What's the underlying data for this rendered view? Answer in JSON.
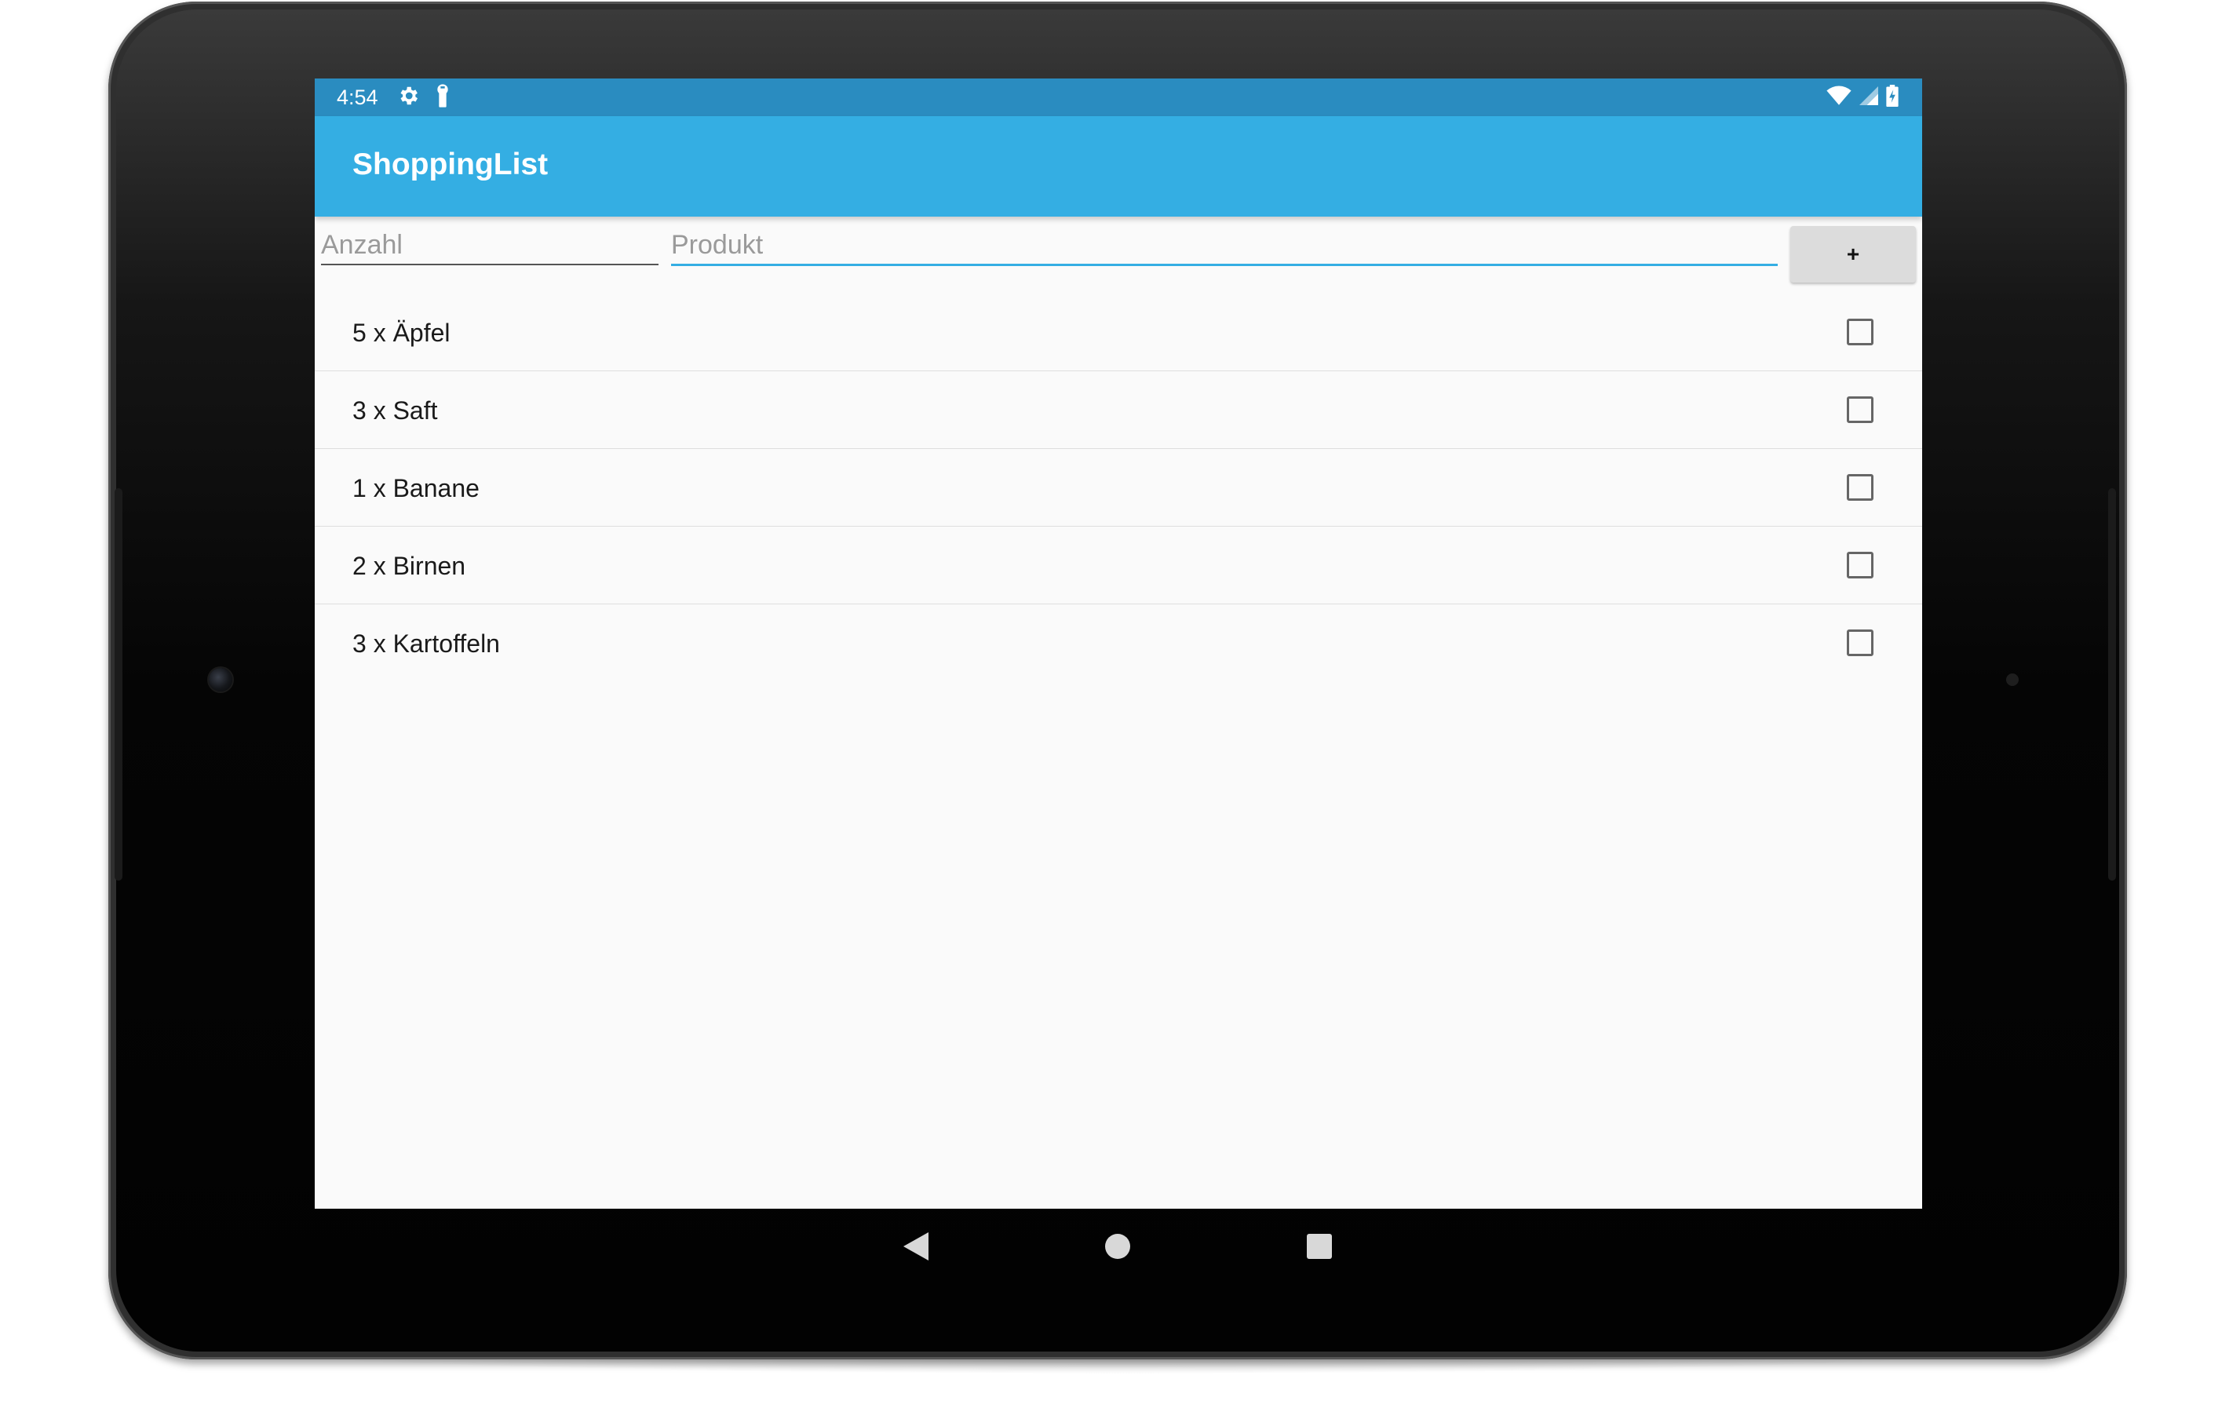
{
  "status_bar": {
    "time": "4:54",
    "left_icons": [
      "gear-icon",
      "key-icon"
    ],
    "right_icons": [
      "wifi-icon",
      "signal-icon",
      "battery-icon"
    ]
  },
  "app_bar": {
    "title": "ShoppingList"
  },
  "input_row": {
    "quantity_placeholder": "Anzahl",
    "quantity_value": "",
    "product_placeholder": "Produkt",
    "product_value": "",
    "add_button_label": "+"
  },
  "items": [
    {
      "label": "5 x Äpfel",
      "checked": false
    },
    {
      "label": "3 x Saft",
      "checked": false
    },
    {
      "label": "1 x Banane",
      "checked": false
    },
    {
      "label": "2 x Birnen",
      "checked": false
    },
    {
      "label": "3 x Kartoffeln",
      "checked": false
    }
  ],
  "nav_bar": {
    "icons": [
      "back-icon",
      "home-icon",
      "recents-icon"
    ]
  },
  "colors": {
    "status_bar": "#2a8cc0",
    "app_bar": "#34aee3",
    "accent": "#34aee3",
    "screen_background": "#fafafa"
  }
}
